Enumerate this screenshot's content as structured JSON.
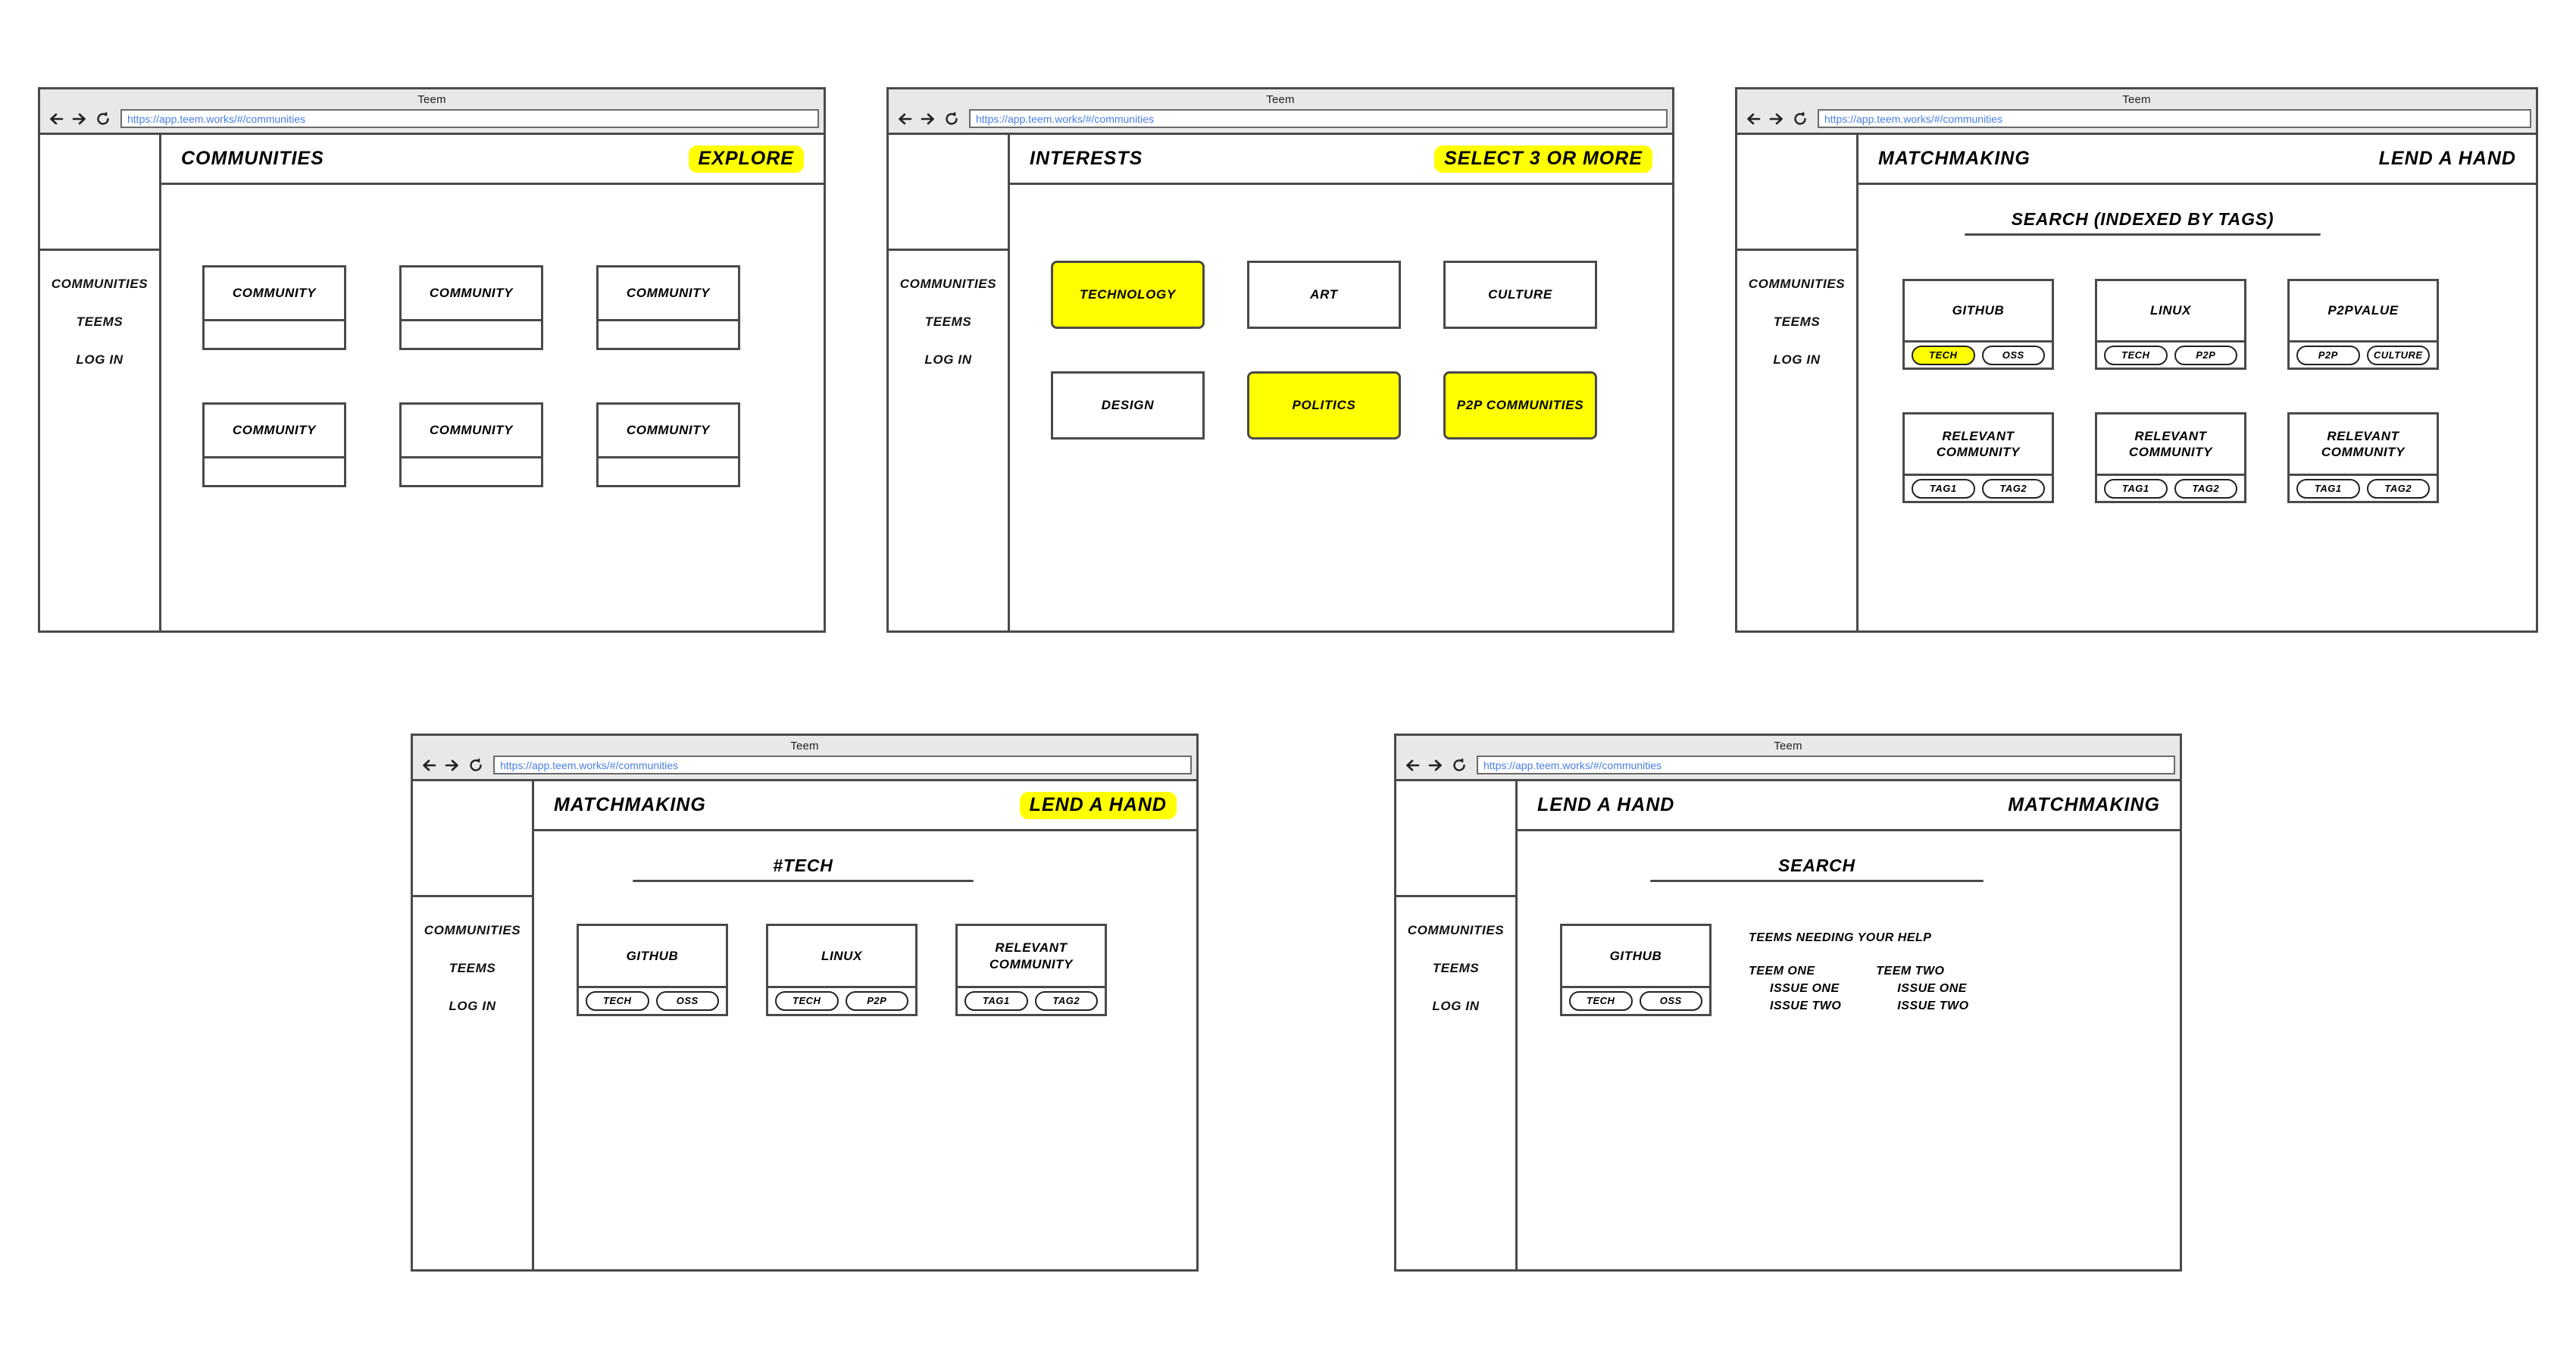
{
  "browser": {
    "window_title": "Teem",
    "url": "https://app.teem.works/#/communities",
    "back_icon": "arrow-left-icon",
    "forward_icon": "arrow-right-icon",
    "reload_icon": "reload-icon"
  },
  "colors": {
    "highlight": "#ffff00",
    "stroke": "#4a4a4a",
    "chrome": "#e8e8e8",
    "url_text": "#4a7fe0"
  },
  "sidebar": {
    "items": [
      {
        "label": "COMMUNITIES"
      },
      {
        "label": "TEEMS"
      },
      {
        "label": "LOG IN"
      }
    ]
  },
  "screens": [
    {
      "id": "communities",
      "topbar": {
        "title": "COMMUNITIES",
        "action": "EXPLORE",
        "action_highlighted": true
      },
      "cards": [
        {
          "title": "COMMUNITY",
          "tags": []
        },
        {
          "title": "COMMUNITY",
          "tags": []
        },
        {
          "title": "COMMUNITY",
          "tags": []
        },
        {
          "title": "COMMUNITY",
          "tags": []
        },
        {
          "title": "COMMUNITY",
          "tags": []
        },
        {
          "title": "COMMUNITY",
          "tags": []
        }
      ]
    },
    {
      "id": "interests",
      "topbar": {
        "title": "INTERESTS",
        "action": "SELECT 3 OR MORE",
        "action_highlighted": true
      },
      "tiles": [
        {
          "label": "TECHNOLOGY",
          "selected": true
        },
        {
          "label": "ART",
          "selected": false
        },
        {
          "label": "CULTURE",
          "selected": false
        },
        {
          "label": "DESIGN",
          "selected": false
        },
        {
          "label": "POLITICS",
          "selected": true
        },
        {
          "label": "P2P COMMUNITIES",
          "selected": true
        }
      ]
    },
    {
      "id": "matchmaking-search",
      "topbar": {
        "title": "MATCHMAKING",
        "action": "LEND A HAND",
        "action_highlighted": false
      },
      "search_heading": "SEARCH (INDEXED BY TAGS)",
      "cards": [
        {
          "title": "GITHUB",
          "tags": [
            {
              "label": "TECH",
              "selected": true
            },
            {
              "label": "OSS",
              "selected": false
            }
          ]
        },
        {
          "title": "LINUX",
          "tags": [
            {
              "label": "TECH",
              "selected": false
            },
            {
              "label": "P2P",
              "selected": false
            }
          ]
        },
        {
          "title": "P2PVALUE",
          "tags": [
            {
              "label": "P2P",
              "selected": false
            },
            {
              "label": "CULTURE",
              "selected": false
            }
          ]
        },
        {
          "title": "RELEVANT\nCOMMUNITY",
          "tags": [
            {
              "label": "TAG1",
              "selected": false
            },
            {
              "label": "TAG2",
              "selected": false
            }
          ]
        },
        {
          "title": "RELEVANT\nCOMMUNITY",
          "tags": [
            {
              "label": "TAG1",
              "selected": false
            },
            {
              "label": "TAG2",
              "selected": false
            }
          ]
        },
        {
          "title": "RELEVANT\nCOMMUNITY",
          "tags": [
            {
              "label": "TAG1",
              "selected": false
            },
            {
              "label": "TAG2",
              "selected": false
            }
          ]
        }
      ]
    },
    {
      "id": "matchmaking-tech",
      "topbar": {
        "title": "MATCHMAKING",
        "action": "LEND A HAND",
        "action_highlighted": true
      },
      "search_heading": "#TECH",
      "cards": [
        {
          "title": "GITHUB",
          "tags": [
            {
              "label": "TECH",
              "selected": false
            },
            {
              "label": "OSS",
              "selected": false
            }
          ]
        },
        {
          "title": "LINUX",
          "tags": [
            {
              "label": "TECH",
              "selected": false
            },
            {
              "label": "P2P",
              "selected": false
            }
          ]
        },
        {
          "title": "RELEVANT\nCOMMUNITY",
          "tags": [
            {
              "label": "TAG1",
              "selected": false
            },
            {
              "label": "TAG2",
              "selected": false
            }
          ]
        }
      ]
    },
    {
      "id": "lend-a-hand",
      "topbar": {
        "title": "LEND A HAND",
        "action": "MATCHMAKING",
        "action_highlighted": false
      },
      "search_heading": "SEARCH",
      "cards": [
        {
          "title": "GITHUB",
          "tags": [
            {
              "label": "TECH",
              "selected": false
            },
            {
              "label": "OSS",
              "selected": false
            }
          ]
        }
      ],
      "help": {
        "heading": "TEEMS NEEDING YOUR HELP",
        "columns": [
          {
            "teem": "TEEM ONE",
            "issues": [
              "ISSUE ONE",
              "ISSUE TWO"
            ]
          },
          {
            "teem": "TEEM TWO",
            "issues": [
              "ISSUE ONE",
              "ISSUE TWO"
            ]
          }
        ]
      }
    }
  ]
}
